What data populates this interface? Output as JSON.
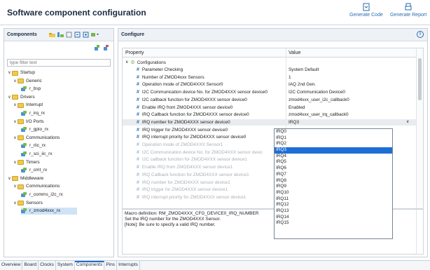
{
  "window": {
    "title": "Software component configuration"
  },
  "toolbar": {
    "generate_code": "Generate Code",
    "generate_report": "Generate Report"
  },
  "components_panel": {
    "label": "Components",
    "filter_placeholder": "type filter text",
    "tree": [
      {
        "label": "Startup",
        "type": "folder",
        "level": 1,
        "expanded": true
      },
      {
        "label": "Generic",
        "type": "folder",
        "level": 2,
        "expanded": true
      },
      {
        "label": "r_bsp",
        "type": "component",
        "level": 3
      },
      {
        "label": "Drivers",
        "type": "folder",
        "level": 1,
        "expanded": true
      },
      {
        "label": "Interrupt",
        "type": "folder",
        "level": 2,
        "expanded": true
      },
      {
        "label": "r_irq_rx",
        "type": "component",
        "level": 3
      },
      {
        "label": "I/O Ports",
        "type": "folder",
        "level": 2,
        "expanded": true
      },
      {
        "label": "r_gpio_rx",
        "type": "component",
        "level": 3
      },
      {
        "label": "Communications",
        "type": "folder",
        "level": 2,
        "expanded": true
      },
      {
        "label": "r_riic_rx",
        "type": "component",
        "level": 3
      },
      {
        "label": "r_sci_iic_rx",
        "type": "component",
        "level": 3
      },
      {
        "label": "Timers",
        "type": "folder",
        "level": 2,
        "expanded": true
      },
      {
        "label": "r_cmt_rx",
        "type": "component",
        "level": 3
      },
      {
        "label": "Middleware",
        "type": "folder",
        "level": 1,
        "expanded": true
      },
      {
        "label": "Communications",
        "type": "folder",
        "level": 2,
        "expanded": true
      },
      {
        "label": "r_comms_i2c_rx",
        "type": "component",
        "level": 3
      },
      {
        "label": "Sensors",
        "type": "folder",
        "level": 2,
        "expanded": true
      },
      {
        "label": "r_zmod4xxx_rx",
        "type": "component",
        "level": 3,
        "selected": true
      }
    ]
  },
  "configure_panel": {
    "label": "Configure",
    "col_property": "Property",
    "col_value": "Value",
    "group": "Configurations",
    "rows": [
      {
        "name": "Parameter Checking",
        "value": "System Default"
      },
      {
        "name": "Number of ZMOD4xxx Sensors",
        "value": "1"
      },
      {
        "name": "Operation mode of ZMOD4XXX Sensor0",
        "value": "IAQ 2nd Gen."
      },
      {
        "name": "I2C Communication device No. for ZMOD4XXX sensor device0",
        "value": "I2C Communication Device0"
      },
      {
        "name": "I2C callback function for ZMOD4XXX sensor device0",
        "value": "zmod4xxx_user_i2c_callback0"
      },
      {
        "name": "Enable IRQ from ZMOD4XXX sensor device0",
        "value": "Enabled"
      },
      {
        "name": "IRQ Callback function for ZMOD4XXX sensor device0",
        "value": "zmod4xxx_user_irq_callback0"
      },
      {
        "name": "IRQ number for ZMOD4XXX sensor device0",
        "value": "IRQ3",
        "highlight": true
      },
      {
        "name": "IRQ trigger for ZMOD4XXX sensor device0",
        "value": ""
      },
      {
        "name": "IRQ interrupt priority for ZMOD4XXX sensor device0",
        "value": ""
      },
      {
        "name": "Operation mode of ZMOD4XXX Sensor1",
        "value": "",
        "disabled": true
      },
      {
        "name": "I2C Communication device No. for ZMOD4XXX sensor devic",
        "value": "",
        "disabled": true
      },
      {
        "name": "I2C callback function for ZMOD4XXX sensor device1",
        "value": "",
        "disabled": true
      },
      {
        "name": "Enable IRQ from ZMOD4XXX sensor device1",
        "value": "",
        "disabled": true
      },
      {
        "name": "IRQ Callback function for ZMOD4XXX sensor device1",
        "value": "",
        "disabled": true
      },
      {
        "name": "IRQ number for ZMOD4XXX sensor device1",
        "value": "",
        "disabled": true
      },
      {
        "name": "IRQ trigger for ZMOD4XXX sensor device1",
        "value": "",
        "disabled": true
      },
      {
        "name": "IRQ interrupt priority for ZMOD4XXX sensor device1",
        "value": "",
        "disabled": true
      }
    ],
    "dropdown": {
      "options": [
        "IRQ0",
        "IRQ1",
        "IRQ2",
        "IRQ3",
        "IRQ4",
        "IRQ5",
        "IRQ6",
        "IRQ7",
        "IRQ8",
        "IRQ9",
        "IRQ10",
        "IRQ11",
        "IRQ12",
        "IRQ13",
        "IRQ14",
        "IRQ15"
      ],
      "selected": "IRQ3"
    },
    "description": [
      "Macro definition: RM_ZMOD4XXX_CFG_DEVICE0_IRQ_NUMBER",
      "Set the IRQ number for the ZMOD4XXX Sensor.",
      "[Note]: Be sure to specify a valid IRQ number."
    ]
  },
  "bottom_tabs": [
    "Overview",
    "Board",
    "Clocks",
    "System",
    "Components",
    "Pins",
    "Interrupts"
  ],
  "active_tab": "Components",
  "colors": {
    "accent": "#1e6ed6",
    "folder": "#f2c94c",
    "hash": "#2a6ab0"
  }
}
